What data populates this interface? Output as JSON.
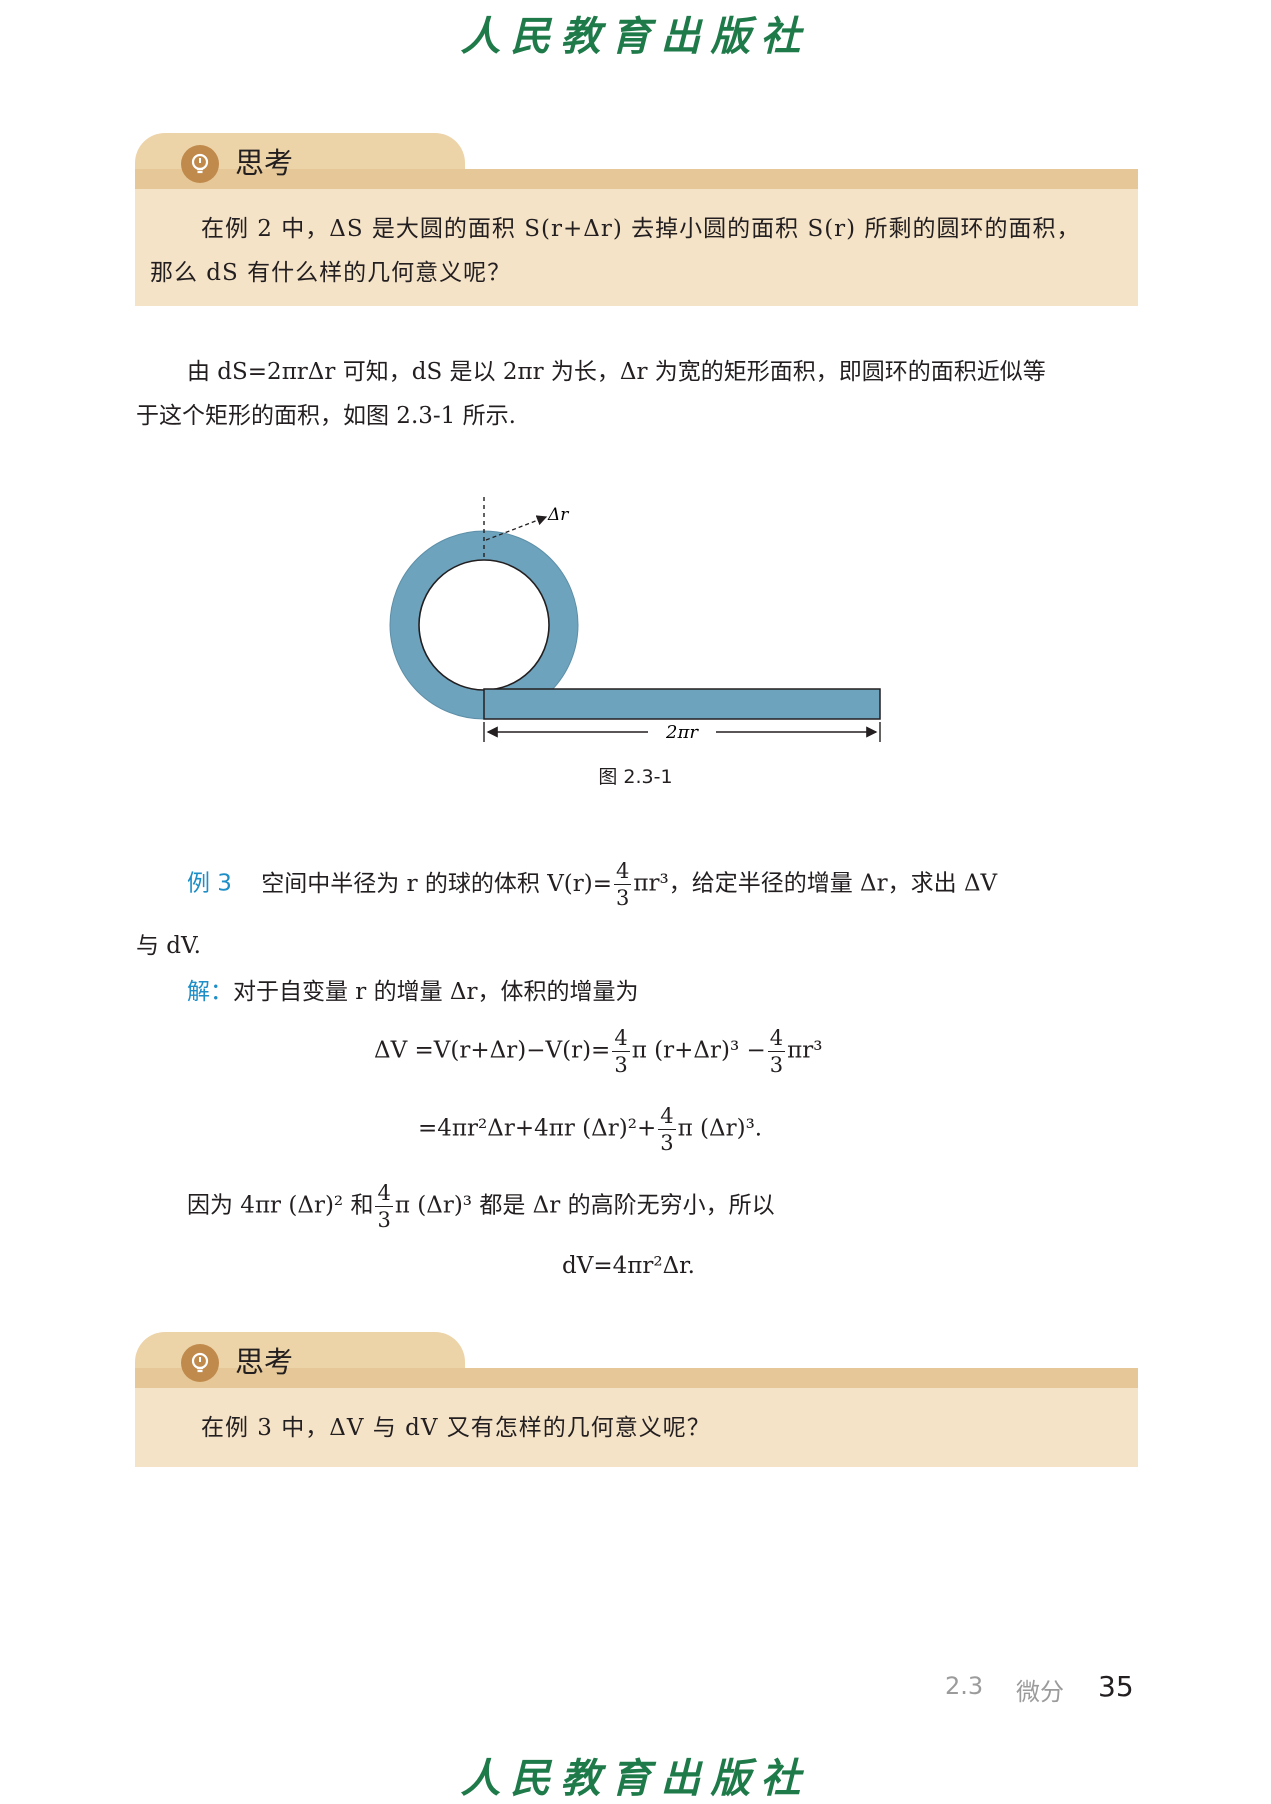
{
  "brand": "人民教育出版社",
  "think1": {
    "title": "思考",
    "line1": "在例 2 中，ΔS 是大圆的面积 S(r+Δr) 去掉小圆的面积 S(r) 所剩的圆环的面积，",
    "line2": "那么 dS 有什么样的几何意义呢？"
  },
  "para1": {
    "line1": "由 dS=2πrΔr 可知，dS 是以 2πr 为长，Δr 为宽的矩形面积，即圆环的面积近似等",
    "line2": "于这个矩形的面积，如图 2.3-1 所示."
  },
  "figure": {
    "dr_label": "Δr",
    "len_label": "2πr",
    "caption": "图 2.3-1"
  },
  "example3": {
    "label": "例 3",
    "text_before": "空间中半径为 r 的球的体积 V(r)=",
    "text_after": "πr³，给定半径的增量 Δr，求出 ΔV",
    "line2": "与 dV."
  },
  "solution": {
    "label": "解：",
    "intro": "对于自变量 r 的增量 Δr，体积的增量为",
    "eq1_a": "ΔV =V(r+Δr)−V(r)=",
    "eq1_b": "π (r+Δr)³ −",
    "eq1_c": "πr³",
    "eq2_a": "=4πr²Δr+4πr (Δr)²+",
    "eq2_b": "π (Δr)³.",
    "because_a": "因为 4πr (Δr)² 和",
    "because_b": "π (Δr)³ 都是 Δr 的高阶无穷小，所以",
    "result": "dV=4πr²Δr."
  },
  "frac": {
    "num": "4",
    "den": "3"
  },
  "think2": {
    "title": "思考",
    "line1": "在例 3 中，ΔV 与 dV 又有怎样的几何意义呢？"
  },
  "footer": {
    "section": "2.3",
    "title": "微分",
    "page": "35"
  }
}
